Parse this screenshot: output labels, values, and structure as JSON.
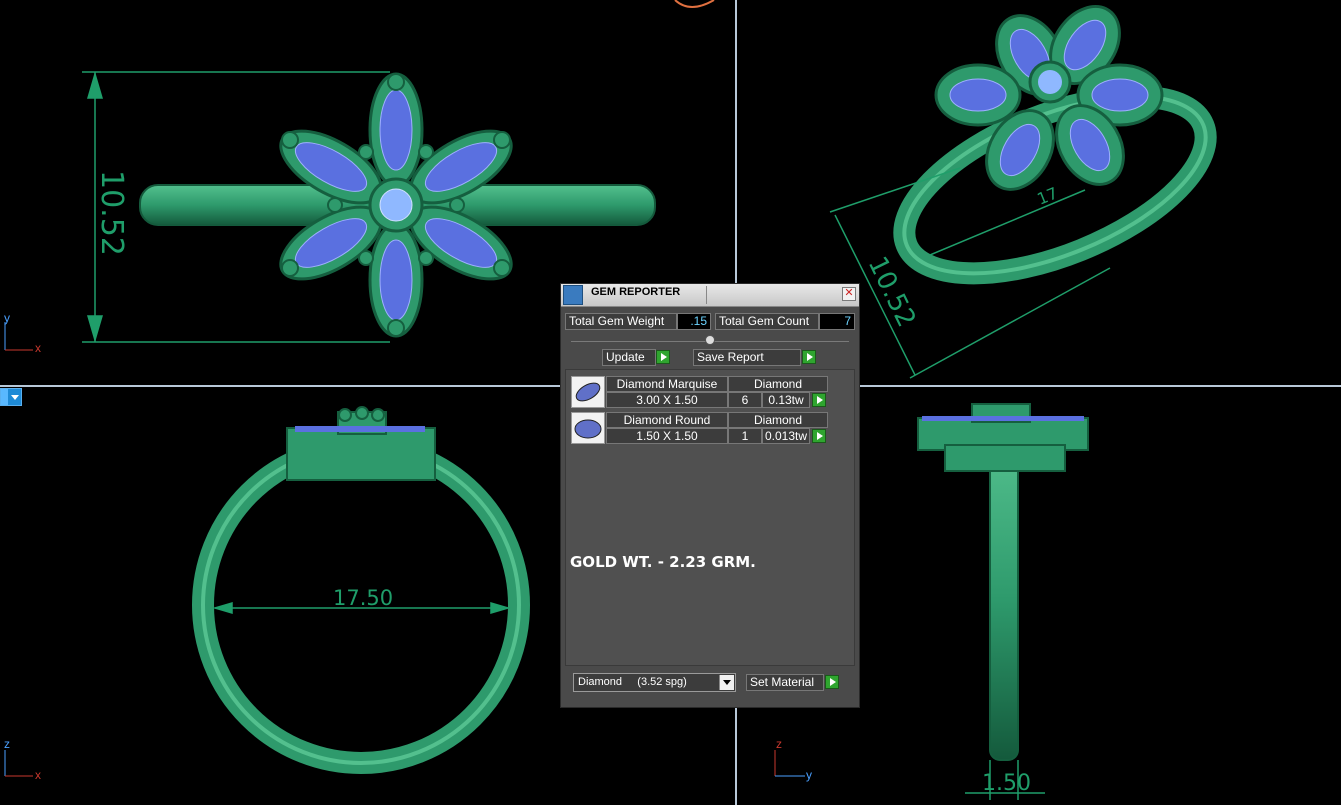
{
  "viewports": {
    "top_left_dimension": "10.52",
    "top_right_dimension_a": "10.52",
    "top_right_dimension_b": "17",
    "bottom_left_dimension": "17.50",
    "bottom_right_dimension": "1.50",
    "axis_labels": {
      "top_left": {
        "v": "y",
        "h": "x"
      },
      "bottom_left": {
        "v": "z",
        "h": "x"
      },
      "bottom_right": {
        "v": "z",
        "h": "y"
      }
    }
  },
  "gem_reporter": {
    "title": "GEM REPORTER",
    "close_glyph": "✕",
    "total_gem_weight_label": "Total Gem Weight",
    "total_gem_weight_value": ".15",
    "total_gem_count_label": "Total Gem Count",
    "total_gem_count_value": "7",
    "update_label": "Update",
    "save_report_label": "Save Report",
    "gems": [
      {
        "name": "Diamond Marquise",
        "material": "Diamond",
        "size": "3.00 X 1.50",
        "count": "6",
        "weight": "0.13tw",
        "shape": "marquise"
      },
      {
        "name": "Diamond Round",
        "material": "Diamond",
        "size": "1.50 X 1.50",
        "count": "1",
        "weight": "0.013tw",
        "shape": "round"
      }
    ],
    "note": "GOLD WT. - 2.23 GRM.",
    "material_select": "Diamond     (3.52 spg)",
    "set_material_label": "Set Material"
  },
  "colors": {
    "metal": "#2e9a6c",
    "gem": "#5a70e0",
    "dimension": "#1f9e6a",
    "viewport_divider": "#b8c8d8",
    "background": "#000000"
  }
}
